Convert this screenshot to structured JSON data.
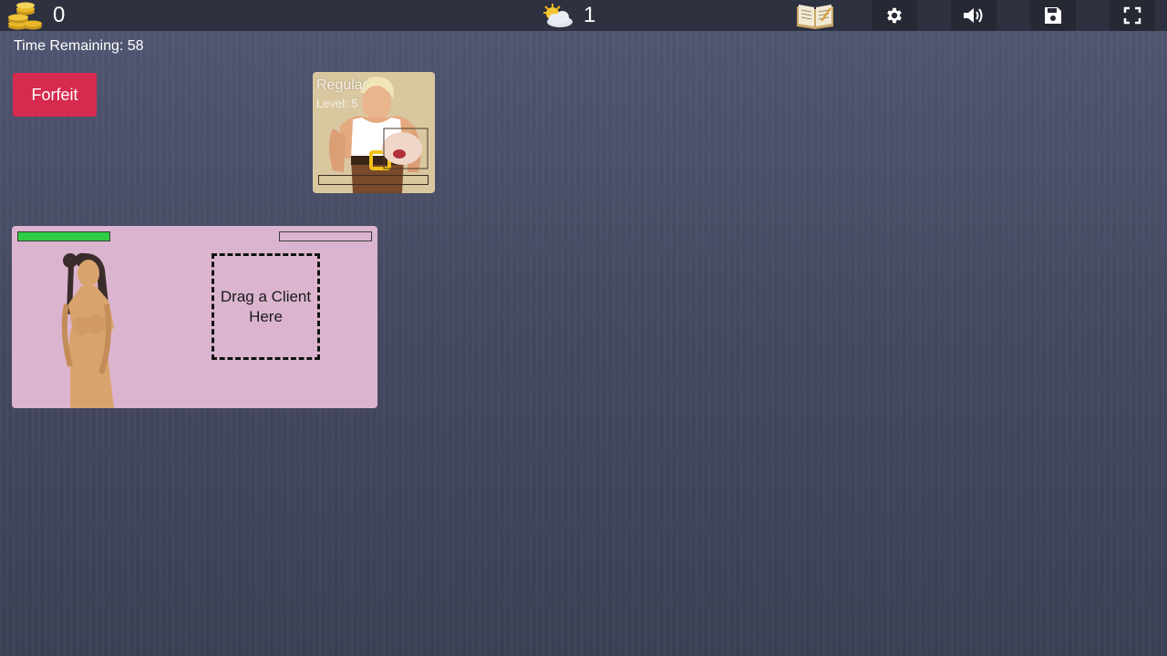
{
  "hud": {
    "gold": "0",
    "day": "1",
    "time_label": "Time Remaining: 58"
  },
  "icons": {
    "gold": "coin-stack-icon",
    "day": "sun-cloud-icon",
    "journal": "open-book-icon",
    "settings": "gear-icon",
    "sound": "speaker-icon",
    "save": "floppy-disk-icon",
    "fullscreen": "fullscreen-icon"
  },
  "actions": {
    "forfeit_label": "Forfeit"
  },
  "client": {
    "type": "Regular",
    "level": "Level: 5",
    "progress": 0
  },
  "station": {
    "stamina": 1.0,
    "progress": 0,
    "drop_label": "Drag a Client Here"
  },
  "colors": {
    "accent_red": "#d62a4e",
    "stamina_green": "#2fcc45",
    "station_bg": "#dbb5cf",
    "card_bg": "#d9c7a0"
  }
}
